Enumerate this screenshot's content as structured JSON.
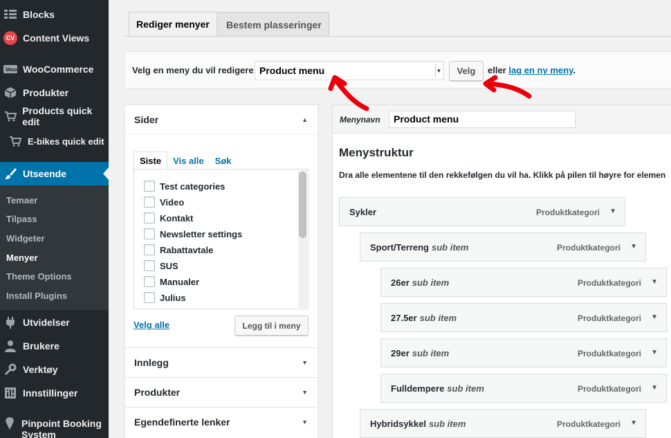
{
  "sidebar": {
    "items": [
      {
        "label": "Blocks",
        "icon": "blocks-icon"
      },
      {
        "label": "Content Views",
        "icon": "cv-icon"
      },
      {
        "label": "WooCommerce",
        "icon": "woo-icon"
      },
      {
        "label": "Produkter",
        "icon": "box-icon"
      },
      {
        "label": "Products quick edit",
        "icon": "cart-icon"
      },
      {
        "label": "E-bikes quick edit",
        "icon": "cart-icon"
      },
      {
        "label": "Utseende",
        "icon": "brush-icon"
      },
      {
        "label": "Utvidelser",
        "icon": "plugin-icon"
      },
      {
        "label": "Brukere",
        "icon": "user-icon"
      },
      {
        "label": "Verktøy",
        "icon": "wrench-icon"
      },
      {
        "label": "Innstillinger",
        "icon": "settings-icon"
      },
      {
        "label": "Pinpoint Booking System",
        "icon": "pin-icon"
      }
    ],
    "cv_badge": "CV",
    "submenu": [
      "Temaer",
      "Tilpass",
      "Widgeter",
      "Menyer",
      "Theme Options",
      "Install Plugins"
    ]
  },
  "tabs": {
    "edit": "Rediger menyer",
    "locations": "Bestem plasseringer"
  },
  "select_bar": {
    "label": "Velg en meny du vil redigere:",
    "selected": "Product menu",
    "button": "Velg",
    "or_text": "eller",
    "create_link": "lag en ny meny",
    "period": "."
  },
  "left": {
    "pages_title": "Sider",
    "tabs": [
      "Siste",
      "Vis alle",
      "Søk"
    ],
    "pages": [
      "Test categories",
      "Video",
      "Kontakt",
      "Newsletter settings",
      "Rabattavtale",
      "SUS",
      "Manualer",
      "Julius"
    ],
    "select_all": "Velg alle",
    "add_button": "Legg til i meny",
    "sections": [
      "Innlegg",
      "Produkter",
      "Egendefinerte lenker"
    ]
  },
  "right": {
    "name_label": "Menynavn",
    "name_value": "Product menu",
    "structure_title": "Menystruktur",
    "structure_desc": "Dra alle elementene til den rekkefølgen du vil ha. Klikk på pilen til høyre for elemen",
    "items": [
      {
        "title": "Sykler",
        "sub": "",
        "type": "Produktkategori"
      },
      {
        "title": "Sport/Terreng",
        "sub": "sub item",
        "type": "Produktkategori"
      },
      {
        "title": "26er",
        "sub": "sub item",
        "type": "Produktkategori"
      },
      {
        "title": "27.5er",
        "sub": "sub item",
        "type": "Produktkategori"
      },
      {
        "title": "29er",
        "sub": "sub item",
        "type": "Produktkategori"
      },
      {
        "title": "Fulldempere",
        "sub": "sub item",
        "type": "Produktkategori"
      },
      {
        "title": "Hybridsykkel",
        "sub": "sub item",
        "type": "Produktkategori"
      }
    ]
  },
  "colors": {
    "admin_bg": "#23282d",
    "accent": "#0073aa",
    "annotation": "#e8000b"
  }
}
